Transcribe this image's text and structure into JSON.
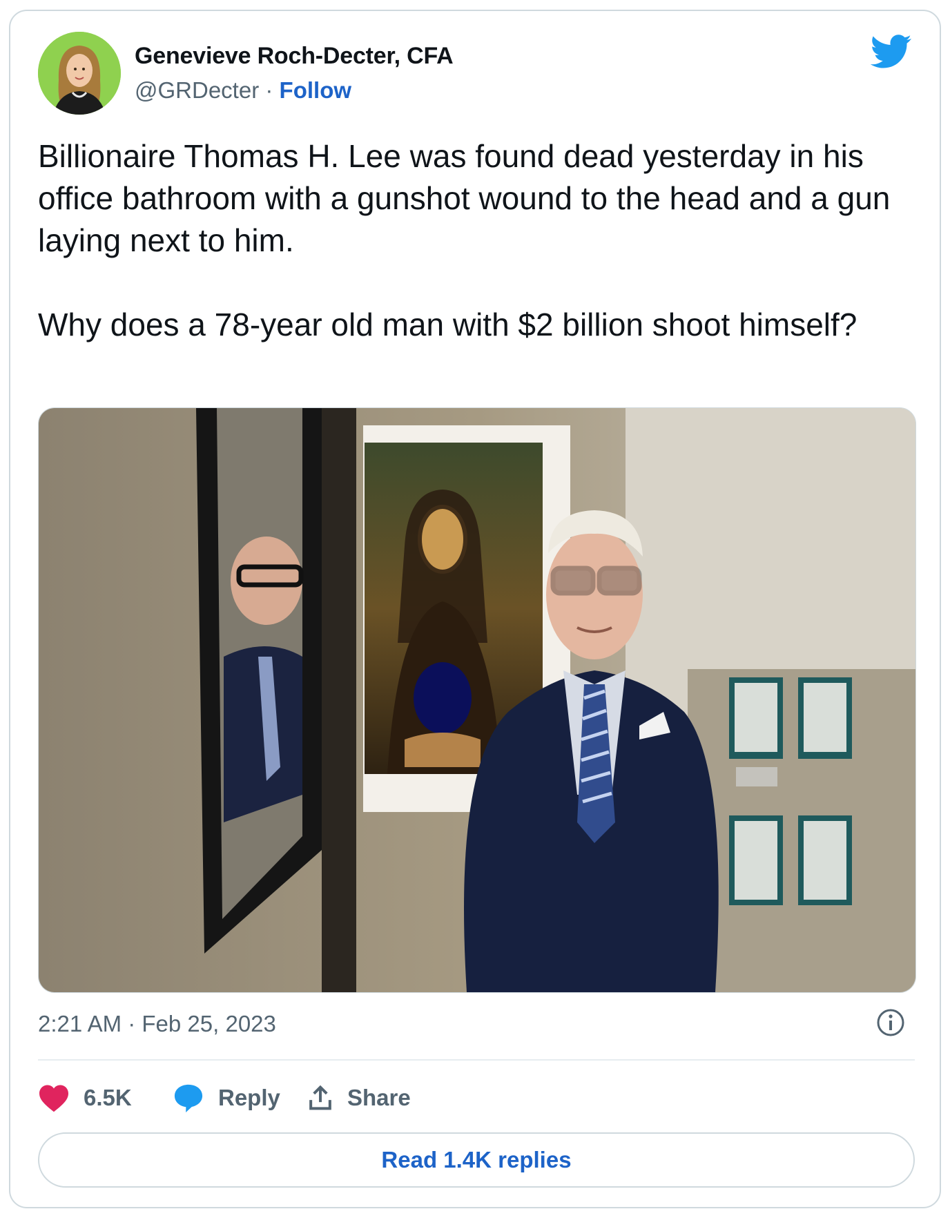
{
  "author": {
    "name": "Genevieve Roch-Decter, CFA",
    "handle": "@GRDecter",
    "separator": "·",
    "follow_label": "Follow",
    "avatar_icon": "avatar-photo-woman",
    "avatar_bg": "#8fd14f"
  },
  "brand_icon": "twitter-bird-icon",
  "brand_color": "#1d9bf0",
  "tweet": {
    "text": "Billionaire Thomas H. Lee was found dead yesterday in his office bathroom with a gunshot wound to the head and a gun laying next to him.\n\nWhy does a 78-year old man with $2 billion shoot himself?"
  },
  "media": {
    "kind": "photo",
    "subject": "man in suit and glasses standing in office beside framed Mona Lisa painting"
  },
  "meta": {
    "timestamp": "2:21 AM · Feb 25, 2023",
    "info_icon": "info-icon"
  },
  "actions": {
    "like": {
      "icon": "heart-icon",
      "count": "6.5K",
      "color": "#e0245e"
    },
    "reply": {
      "icon": "speech-bubble-icon",
      "label": "Reply",
      "color": "#1d9bf0"
    },
    "share": {
      "icon": "share-upload-icon",
      "label": "Share"
    }
  },
  "footer": {
    "read_replies_label": "Read 1.4K replies"
  }
}
